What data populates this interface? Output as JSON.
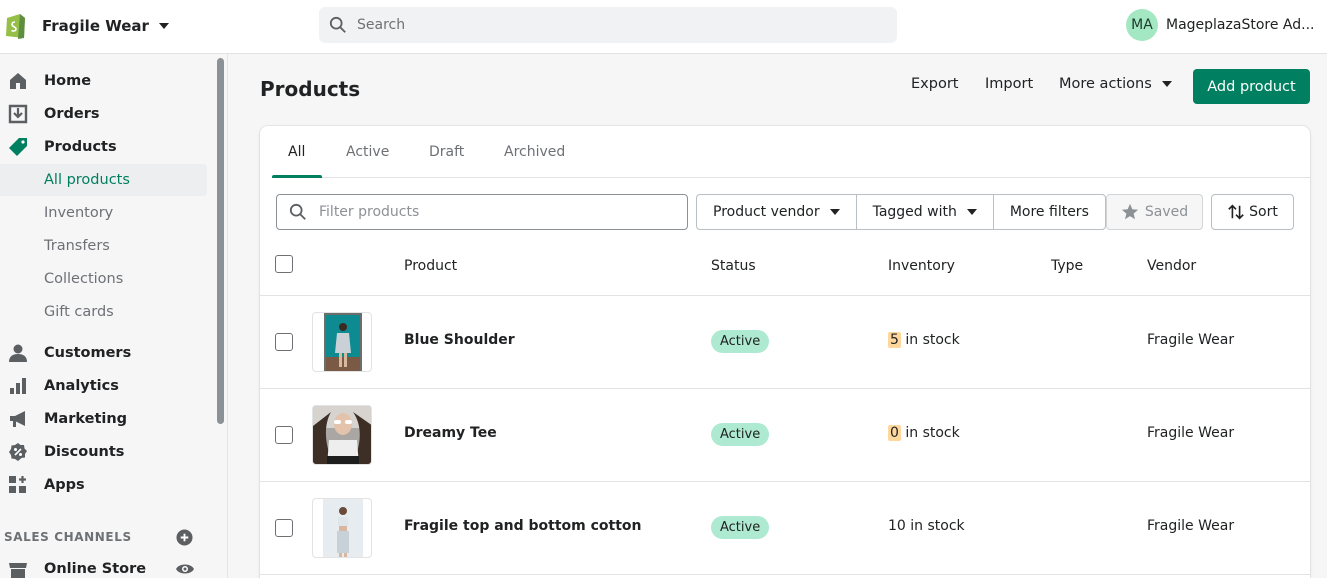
{
  "topbar": {
    "store_name": "Fragile Wear",
    "search_placeholder": "Search",
    "user_initials": "MA",
    "user_name": "MageplazaStore Ad..."
  },
  "sidebar": {
    "items": [
      {
        "label": "Home",
        "icon": "home-icon"
      },
      {
        "label": "Orders",
        "icon": "orders-icon"
      },
      {
        "label": "Products",
        "icon": "tag-icon"
      },
      {
        "label": "All products"
      },
      {
        "label": "Inventory"
      },
      {
        "label": "Transfers"
      },
      {
        "label": "Collections"
      },
      {
        "label": "Gift cards"
      },
      {
        "label": "Customers",
        "icon": "person-icon"
      },
      {
        "label": "Analytics",
        "icon": "bar-chart-icon"
      },
      {
        "label": "Marketing",
        "icon": "megaphone-icon"
      },
      {
        "label": "Discounts",
        "icon": "discount-icon"
      },
      {
        "label": "Apps",
        "icon": "apps-icon"
      }
    ],
    "sales_channels_title": "SALES CHANNELS",
    "online_store": "Online Store"
  },
  "page": {
    "title": "Products",
    "export_label": "Export",
    "import_label": "Import",
    "more_actions_label": "More actions",
    "add_product_label": "Add product"
  },
  "tabs": [
    "All",
    "Active",
    "Draft",
    "Archived"
  ],
  "filters": {
    "search_placeholder": "Filter products",
    "vendor_label": "Product vendor",
    "tagged_label": "Tagged with",
    "more_filters_label": "More filters",
    "saved_label": "Saved",
    "sort_label": "Sort"
  },
  "table": {
    "headers": [
      "Product",
      "Status",
      "Inventory",
      "Type",
      "Vendor"
    ],
    "rows": [
      {
        "name": "Blue Shoulder",
        "status": "Active",
        "stock_num": "5",
        "stock_suffix": " in stock",
        "type": "",
        "vendor": "Fragile Wear"
      },
      {
        "name": "Dreamy Tee",
        "status": "Active",
        "stock_num": "0",
        "stock_suffix": " in stock",
        "type": "",
        "vendor": "Fragile Wear"
      },
      {
        "name": "Fragile top and bottom cotton",
        "status": "Active",
        "stock_full": "10 in stock",
        "type": "",
        "vendor": "Fragile Wear"
      }
    ]
  },
  "colors": {
    "accent": "#008060",
    "badge_active": "#aee9d1",
    "stock_low": "#ffd79d"
  }
}
